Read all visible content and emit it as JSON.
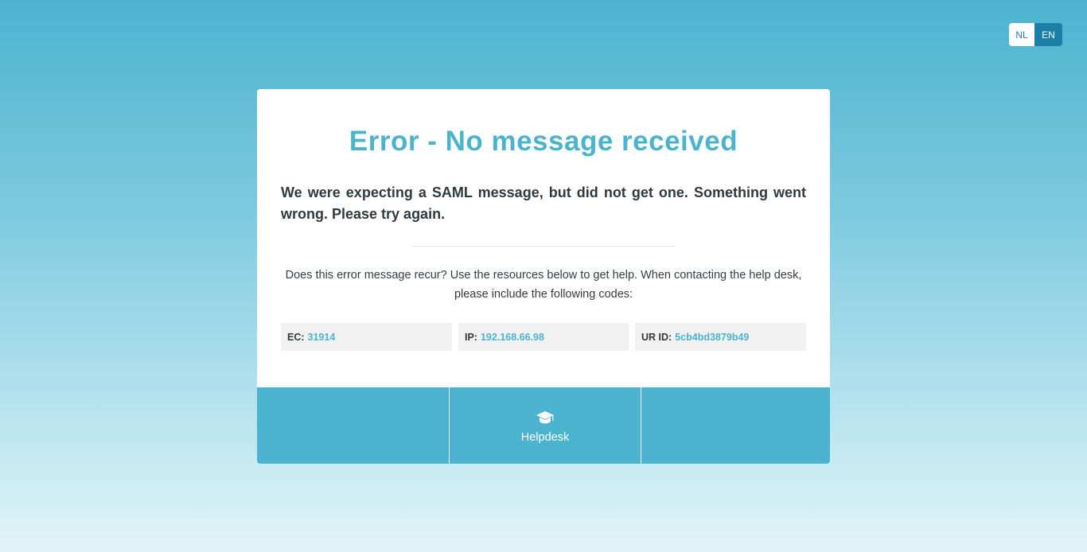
{
  "language": {
    "options": [
      "NL",
      "EN"
    ],
    "active": "EN"
  },
  "error": {
    "title": "Error - No message received",
    "message": "We were expecting a SAML message, but did not get one. Something went wrong. Please try again.",
    "help_text": "Does this error message recur? Use the resources below to get help. When contacting the help desk, please include the following codes:"
  },
  "codes": {
    "ec": {
      "label": "EC:",
      "value": "31914"
    },
    "ip": {
      "label": "IP:",
      "value": "192.168.66.98"
    },
    "ur": {
      "label": "UR ID:",
      "value": "5cb4bd3879b49"
    }
  },
  "footer": {
    "helpdesk_label": "Helpdesk",
    "helpdesk_icon": "graduation-cap-icon"
  },
  "colors": {
    "accent": "#4cb3cf",
    "active_language": "#1c7fa6"
  }
}
